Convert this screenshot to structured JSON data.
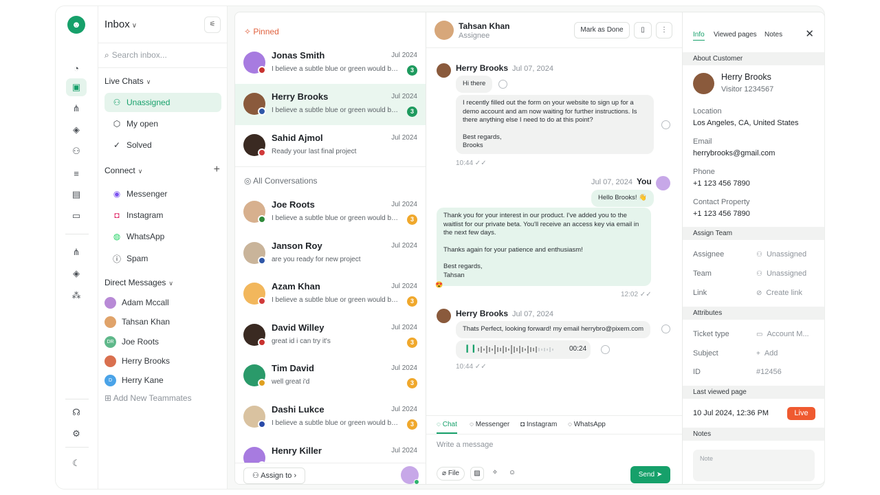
{
  "rail": {
    "icons": [
      "robot-icon",
      "gauge-icon",
      "inbox-icon",
      "hierarchy-icon",
      "bot-icon",
      "users-icon",
      "sliders-icon",
      "report-icon",
      "ticket-icon",
      "hierarchy-icon",
      "bot-icon",
      "flow-icon",
      "headset-icon",
      "gear-icon",
      "moon-icon"
    ]
  },
  "nav": {
    "title": "Inbox",
    "search_placeholder": "Search inbox...",
    "live_chats": "Live Chats",
    "live_items": [
      {
        "label": "Unassigned",
        "icon": "users-icon"
      },
      {
        "label": "My open",
        "icon": "box-icon"
      },
      {
        "label": "Solved",
        "icon": "check-circle-icon"
      }
    ],
    "connect": "Connect",
    "connect_items": [
      {
        "label": "Messenger",
        "icon": "messenger-icon",
        "color": "#7d54f0"
      },
      {
        "label": "Instagram",
        "icon": "instagram-icon",
        "color": "#e1306c"
      },
      {
        "label": "WhatsApp",
        "icon": "whatsapp-icon",
        "color": "#25d366"
      },
      {
        "label": "Spam",
        "icon": "alert-icon",
        "color": "#33383d"
      }
    ],
    "direct_messages": "Direct Messages",
    "dm_items": [
      {
        "label": "Adam Mccall",
        "initials": "",
        "color": "#b88ad6"
      },
      {
        "label": "Tahsan Khan",
        "initials": "",
        "color": "#e0a36a"
      },
      {
        "label": "Joe Roots",
        "initials": "DR",
        "color": "#5fb88a"
      },
      {
        "label": "Herry Brooks",
        "initials": "",
        "color": "#d9704f"
      },
      {
        "label": "Herry Kane",
        "initials": "D",
        "color": "#4aa3e8"
      }
    ],
    "add_teammates": "Add New Teammates"
  },
  "list": {
    "pinned": "Pinned",
    "all": "All Conversations",
    "assign_to": "Assign to",
    "pinned_items": [
      {
        "name": "Jonas Smith",
        "date": "Jul 2024",
        "msg": "I believe a subtle blue or green would be a gr",
        "badge": "3",
        "badge_color": "#1e9a5e",
        "avatar_color": "#a77be0",
        "flag_color": "#c8322f"
      },
      {
        "name": "Herry Brooks",
        "date": "Jul 2024",
        "msg": "I believe a subtle blue or green would be a gr",
        "badge": "3",
        "badge_color": "#1e9a5e",
        "avatar_color": "#8a5a3c",
        "flag_color": "#2f57a8"
      },
      {
        "name": "Sahid Ajmol",
        "date": "Jul 2024",
        "msg": "Ready your last final project",
        "badge": "",
        "badge_color": "#1e9a5e",
        "avatar_color": "#3a2a22",
        "flag_color": "#d13a3a"
      }
    ],
    "all_items": [
      {
        "name": "Joe Roots",
        "date": "Jul 2024",
        "msg": "I believe a subtle blue or green would be a gr",
        "badge": "3",
        "badge_color": "#f0a82c",
        "avatar_color": "#d7b08e",
        "flag_color": "#2f8a3a"
      },
      {
        "name": "Janson Roy",
        "date": "Jul 2024",
        "msg": "are you ready for new project",
        "badge": "",
        "badge_color": "#f0a82c",
        "avatar_color": "#c9b49a",
        "flag_color": "#2f57a8"
      },
      {
        "name": "Azam Khan",
        "date": "Jul 2024",
        "msg": "I believe a subtle blue or green would be a gr",
        "badge": "3",
        "badge_color": "#f0a82c",
        "avatar_color": "#f2b75c",
        "flag_color": "#d13a3a"
      },
      {
        "name": "David Willey",
        "date": "Jul 2024",
        "msg": "great id i can try it's",
        "badge": "3",
        "badge_color": "#f0a82c",
        "avatar_color": "#3a2a22",
        "flag_color": "#c8322f"
      },
      {
        "name": "Tim David",
        "date": "Jul 2024",
        "msg": "well great i'd",
        "badge": "3",
        "badge_color": "#f0a82c",
        "avatar_color": "#2a9a6a",
        "flag_color": "#e0a020"
      },
      {
        "name": "Dashi Lukce",
        "date": "Jul 2024",
        "msg": "I believe a subtle blue or green would be a gr",
        "badge": "3",
        "badge_color": "#f0a82c",
        "avatar_color": "#d9c2a0",
        "flag_color": "#2a4aa8"
      },
      {
        "name": "Henry Killer",
        "date": "Jul 2024",
        "msg": "",
        "badge": "",
        "badge_color": "#f0a82c",
        "avatar_color": "#a77be0",
        "flag_color": "#c8322f"
      }
    ]
  },
  "chat": {
    "header_name": "Tahsan Khan",
    "header_role": "Assignee",
    "mark_done": "Mark as Done",
    "m1_sender": "Herry Brooks",
    "m1_date": "Jul 07, 2024",
    "m1_hi": "Hi there",
    "m1_l1": "I recently filled out the form on your website to sign up for a",
    "m1_l2": "demo account and am now waiting for further instructions. Is",
    "m1_l3": "there anything else I need to do at this point?",
    "m1_l4": "Best regards,",
    "m1_l5": "Brooks",
    "m1_time": "10:44",
    "m2_date": "Jul 07, 2024",
    "m2_sender": "You",
    "m2_hello": "Hello Brooks! 👋",
    "m2_l1": "Thank you for your interest in our product. I've added you to the",
    "m2_l2": "waitlist for our private beta. You'll receive an access key via email in",
    "m2_l3": "the next few days.",
    "m2_l4": "Thanks again for your patience and enthusiasm!",
    "m2_l5": "Best regards,",
    "m2_l6": "Tahsan",
    "m2_time": "12:02",
    "m3_sender": "Herry Brooks",
    "m3_date": "Jul 07, 2024",
    "m3_text": "Thats Perfect, looking forward! my email herrybro@pixem.com",
    "m3_audio": "00:24",
    "m3_time": "10:44",
    "tabs": [
      "Chat",
      "Messenger",
      "Instagram",
      "WhatsApp"
    ],
    "placeholder": "Write a message",
    "file": "File",
    "send": "Send"
  },
  "info": {
    "tabs": [
      "Info",
      "Viewed pages",
      "Notes"
    ],
    "about": "About Customer",
    "cust_name": "Herry Brooks",
    "cust_sub": "Visitor 1234567",
    "loc_label": "Location",
    "loc_val": "Los Angeles, CA, United States",
    "email_label": "Email",
    "email_val": "herrybrooks@gmail.com",
    "phone_label": "Phone",
    "phone_val": "+1 123 456 7890",
    "cp_label": "Contact Property",
    "cp_val": "+1 123 456 7890",
    "assign_team": "Assign Team",
    "assignee_label": "Assignee",
    "assignee_val": "Unassigned",
    "team_label": "Team",
    "team_val": "Unassigned",
    "link_label": "Link",
    "link_val": "Create link",
    "attributes": "Attributes",
    "ticket_label": "Ticket type",
    "ticket_val": "Account M...",
    "subject_label": "Subject",
    "subject_val": "Add",
    "id_label": "ID",
    "id_val": "#12456",
    "last_viewed": "Last viewed page",
    "last_val": "10 Jul 2024, 12:36 PM",
    "live": "Live",
    "notes_bar": "Notes",
    "notes_placeholder": "Note"
  }
}
